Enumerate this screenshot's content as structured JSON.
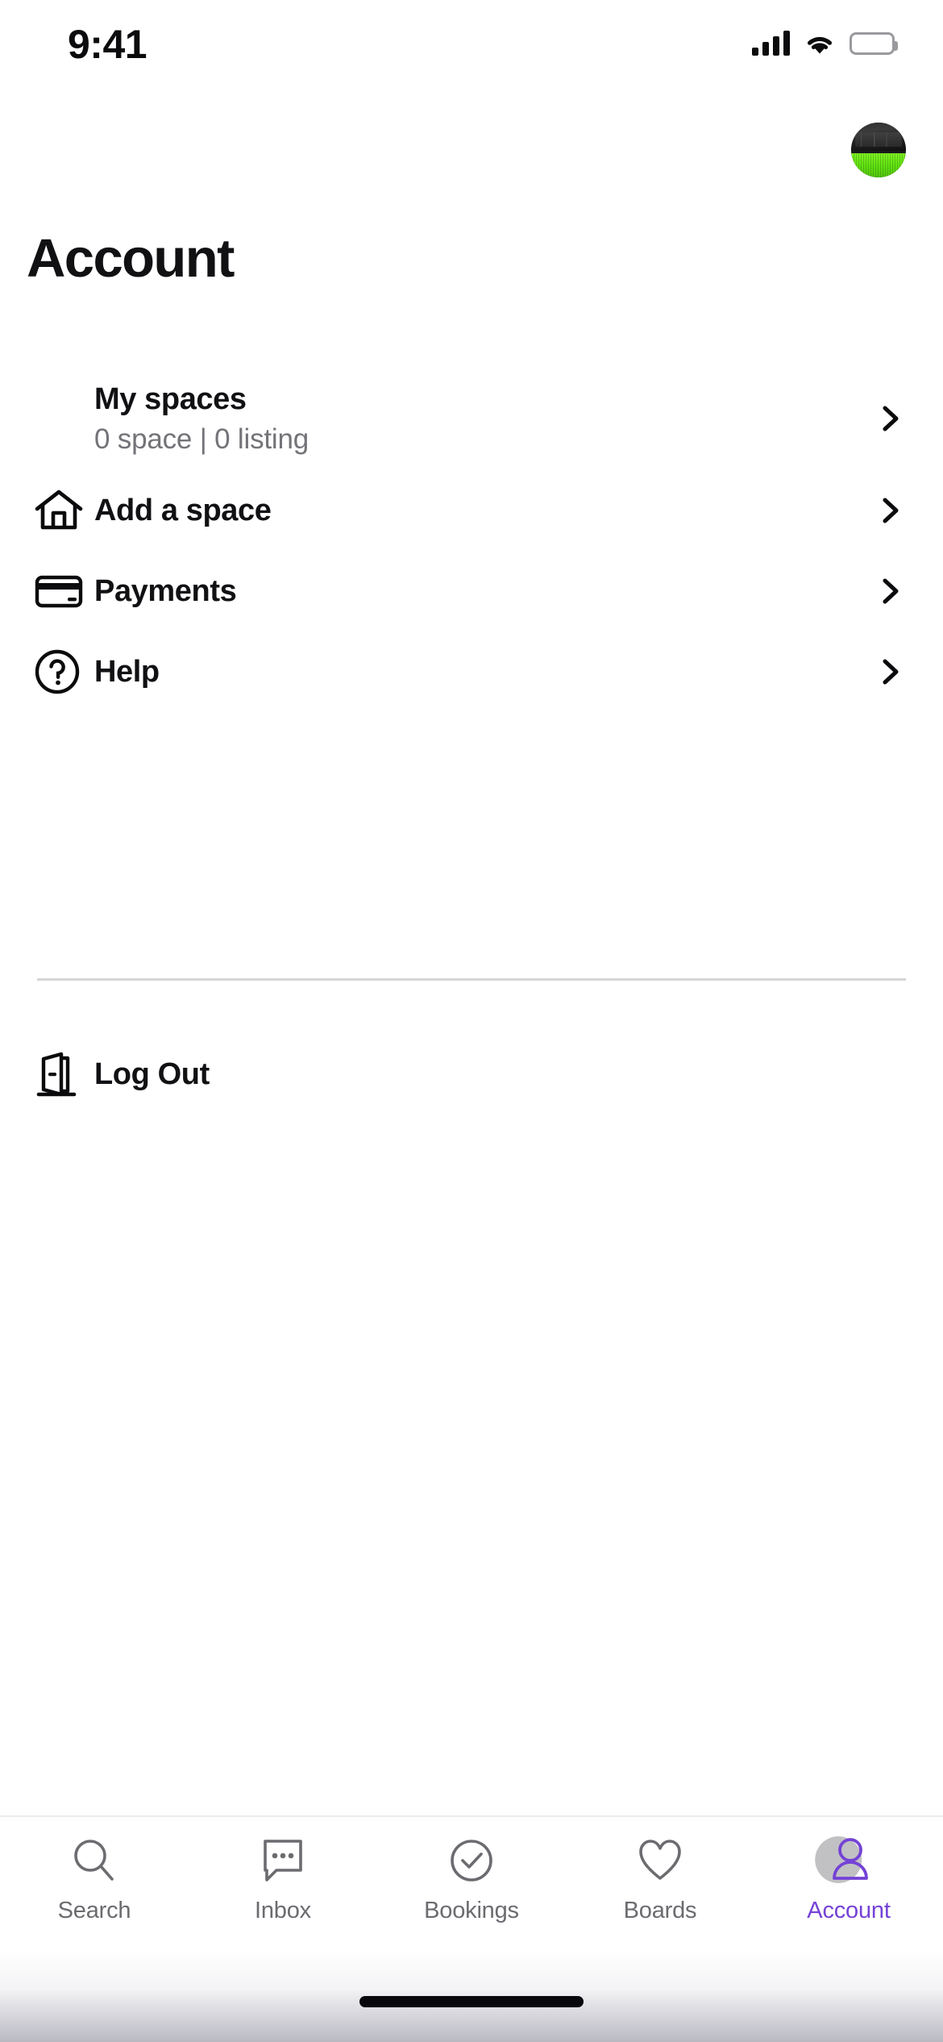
{
  "status_bar": {
    "time": "9:41",
    "cellular_icon": "signal-bars-icon",
    "wifi_icon": "wifi-icon",
    "battery_icon": "battery-full-icon"
  },
  "header": {
    "title": "Account",
    "avatar_icon": "user-avatar-photo"
  },
  "menu": {
    "items": [
      {
        "label": "My spaces",
        "sublabel": "0 space | 0 listing",
        "icon": "",
        "chevron": "chevron-right-icon",
        "has_icon": false
      },
      {
        "label": "Add a space",
        "sublabel": "",
        "icon": "home-icon",
        "chevron": "chevron-right-icon",
        "has_icon": true
      },
      {
        "label": "Payments",
        "sublabel": "",
        "icon": "credit-card-icon",
        "chevron": "chevron-right-icon",
        "has_icon": true
      },
      {
        "label": "Help",
        "sublabel": "",
        "icon": "question-circle-icon",
        "chevron": "chevron-right-icon",
        "has_icon": true
      }
    ],
    "logout": {
      "label": "Log Out",
      "icon": "exit-door-icon"
    }
  },
  "tab_bar": {
    "active_color": "#7442d6",
    "inactive_color": "#6b6b70",
    "tabs": [
      {
        "label": "Search",
        "icon": "search-icon",
        "active": false
      },
      {
        "label": "Inbox",
        "icon": "chat-bubble-icon",
        "active": false
      },
      {
        "label": "Bookings",
        "icon": "check-circle-icon",
        "active": false
      },
      {
        "label": "Boards",
        "icon": "heart-icon",
        "active": false
      },
      {
        "label": "Account",
        "icon": "person-icon",
        "active": true
      }
    ]
  },
  "home_indicator": "home-bar"
}
